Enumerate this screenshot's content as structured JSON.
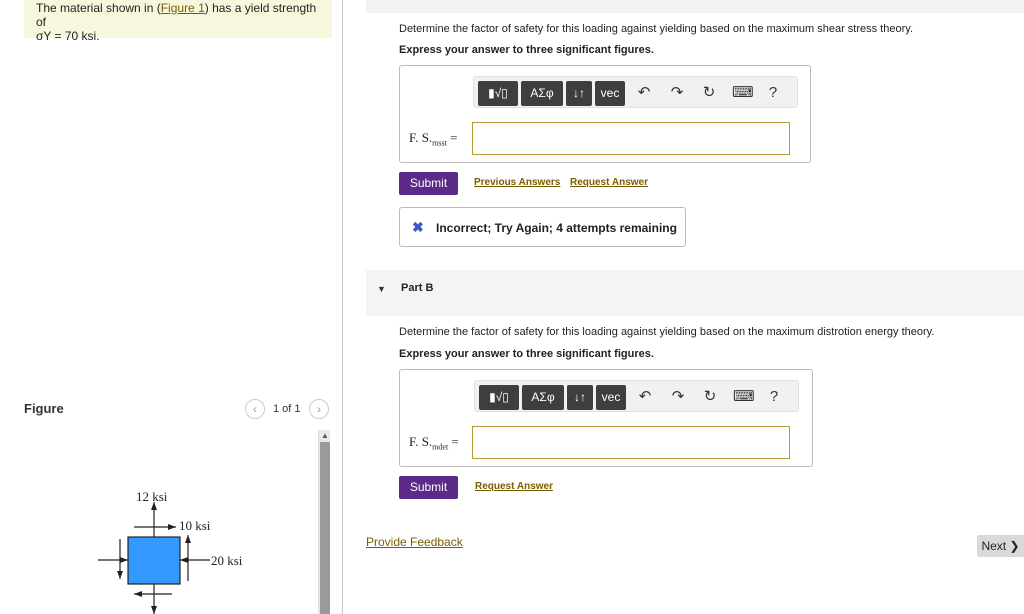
{
  "problem": {
    "text_before_link": "The material shown in (",
    "figure_link": "Figure 1",
    "text_after_link": ") has a yield strength of",
    "sigma_line": "σY = 70 ksi."
  },
  "figure_panel": {
    "title": "Figure",
    "prev_icon": "chevron-left-icon",
    "next_icon": "chevron-right-icon",
    "count": "1 of 1",
    "labels": {
      "vertical_stress": "12 ksi",
      "shear_stress": "10 ksi",
      "horizontal_stress": "20 ksi"
    },
    "element_color": "#3399ff"
  },
  "part_a": {
    "question": "Determine the factor of safety for this loading against yielding based on the maximum shear stress theory.",
    "instruction": "Express your answer to three significant figures.",
    "toolbar": {
      "templates_icon": "templates-icon",
      "greek_label": "ΑΣφ",
      "arrows_label": "↓↑",
      "vec_label": "vec",
      "undo_icon": "undo-icon",
      "redo_icon": "redo-icon",
      "reset_icon": "reset-icon",
      "keyboard_icon": "keyboard-icon",
      "help_label": "?"
    },
    "input_label_main": "F. S.",
    "input_label_sub": "msst",
    "input_label_eq": "=",
    "input_value": "",
    "submit_label": "Submit",
    "previous_answers_label": "Previous Answers",
    "request_answer_label": "Request Answer",
    "feedback_icon": "x-icon",
    "feedback_text": "Incorrect; Try Again; 4 attempts remaining"
  },
  "part_b": {
    "caret_icon": "caret-down-icon",
    "label": "Part B",
    "question": "Determine the factor of safety for this loading against yielding based on the maximum distrotion energy theory.",
    "instruction": "Express your answer to three significant figures.",
    "toolbar": {
      "templates_icon": "templates-icon",
      "greek_label": "ΑΣφ",
      "arrows_label": "↓↑",
      "vec_label": "vec",
      "undo_icon": "undo-icon",
      "redo_icon": "redo-icon",
      "reset_icon": "reset-icon",
      "keyboard_icon": "keyboard-icon",
      "help_label": "?"
    },
    "input_label_main": "F. S.",
    "input_label_sub": "mdet",
    "input_label_eq": "=",
    "input_value": "",
    "submit_label": "Submit",
    "request_answer_label": "Request Answer"
  },
  "footer": {
    "provide_feedback_label": "Provide Feedback",
    "next_label": "Next ❯"
  },
  "colors": {
    "submit": "#5b2a86",
    "link": "#7a5d00",
    "problem_background": "#f6f7dc"
  }
}
